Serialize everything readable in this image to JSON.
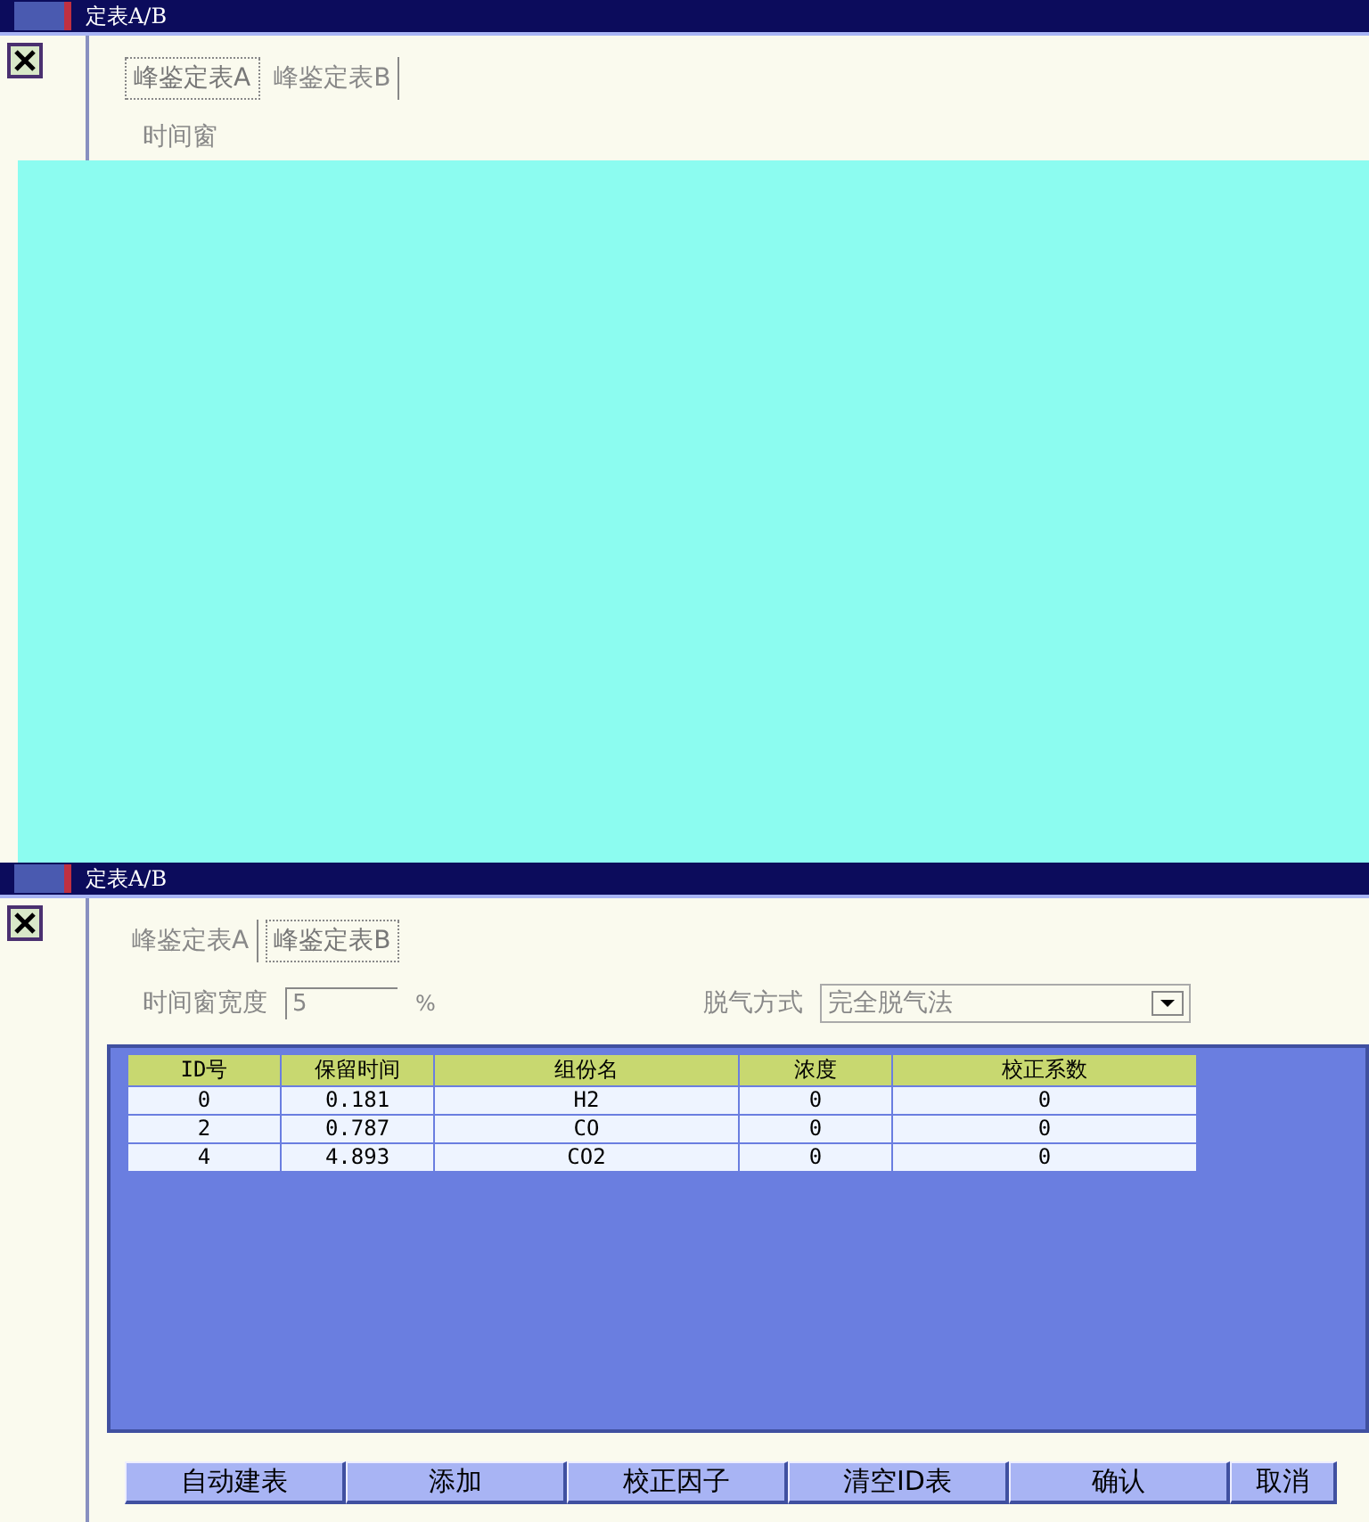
{
  "dialogs": [
    {
      "title": "定表A/B",
      "tabs": [
        {
          "label": "峰鉴定表A",
          "selected": true
        },
        {
          "label": "峰鉴定表B",
          "selected": false
        }
      ],
      "fields": [
        {
          "kind": "label",
          "label": "时间窗"
        }
      ]
    },
    {
      "title": "定表A/B",
      "tabs": [
        {
          "label": "峰鉴定表A",
          "selected": false
        },
        {
          "label": "峰鉴定表B",
          "selected": true
        }
      ],
      "fields": [
        {
          "kind": "input",
          "label": "时间窗宽度",
          "value": "5",
          "unit": "%"
        },
        {
          "kind": "select",
          "label": "脱气方式",
          "value": "完全脱气法"
        }
      ],
      "table": {
        "columns": [
          "ID号",
          "保留时间",
          "组份名",
          "浓度",
          "校正系数"
        ],
        "rows": [
          [
            "0",
            "0.181",
            "H2",
            "0",
            "0"
          ],
          [
            "2",
            "0.787",
            "CO",
            "0",
            "0"
          ],
          [
            "4",
            "4.893",
            "CO2",
            "0",
            "0"
          ]
        ]
      },
      "buttons": [
        "自动建表",
        "添加",
        "校正因子",
        "清空ID表",
        "确认",
        "取消"
      ]
    }
  ]
}
